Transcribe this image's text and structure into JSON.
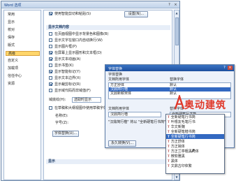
{
  "window": {
    "title": "Word 选项",
    "help": "?",
    "close": "×"
  },
  "sidebar": {
    "items": [
      {
        "label": "常用"
      },
      {
        "label": "显示"
      },
      {
        "label": "校对"
      },
      {
        "label": "保存"
      },
      {
        "label": "版式"
      },
      {
        "label": "高级"
      },
      {
        "label": "自定义"
      },
      {
        "label": "加载项"
      },
      {
        "label": "信任中心"
      },
      {
        "label": "资源"
      }
    ],
    "active_index": 5
  },
  "main": {
    "top_option": "使用智能剪切和粘贴(S)",
    "settings_button": "设置(N)...",
    "section_show_doc": "显示文档内容",
    "options": [
      {
        "label": "在页面视图中显示背景色和图像(B)",
        "checked": false
      },
      {
        "label": "显示文字在窗口内自动换行(W)",
        "checked": false
      },
      {
        "label": "显示图片框(P)",
        "checked": false
      },
      {
        "label": "在屏幕上显示图形和文本框(D)",
        "checked": true
      },
      {
        "label": "显示文本动画(A)",
        "checked": true
      },
      {
        "label": "显示书签(K)",
        "checked": false
      },
      {
        "label": "显示智能标记(Y)",
        "checked": true
      },
      {
        "label": "显示文本边界(X)",
        "checked": false
      },
      {
        "label": "显示裁剪标记(R)",
        "checked": true
      },
      {
        "label": "显示域代码而非域值(F)",
        "checked": false
      }
    ],
    "field_shading_label": "域底纹(H):",
    "field_shading_value": "选取时显示",
    "draft_option": "在草稿和大纲视图中使用草稿字体",
    "name_label": "名称(E):",
    "size_label": "字号(Z):",
    "font_sub_button": "字体替换(U)...",
    "section_display": "显示"
  },
  "dialog": {
    "title": "字体替换",
    "help": "?",
    "close": "×",
    "sub_label": "字体替换",
    "missing_label": "文档所用字体",
    "replace_label": "替换字体",
    "list_missing": [
      {
        "name": "方正舒体",
        "replace": "默认"
      },
      {
        "name": "汉鼎简行楷",
        "replace": "默认"
      },
      {
        "name": "文鼎新颖宋体",
        "replace": "默认"
      }
    ],
    "selected_index": 1,
    "font_used_label": "文档所用字体",
    "font_used_value": "汉鼎简行楷",
    "replace_font_label": "替换字体",
    "replace_font_value": "全新硬笔行书简",
    "note": "\"汉鼎简行楷\" 将以 \"全新硬笔行书简\" 来显示",
    "permanent_button": "永久转换(V)..."
  },
  "dropdown": {
    "items": [
      {
        "label": "全新硬笔行书简",
        "selected": false
      },
      {
        "label": "叶根友毛笔行书",
        "selected": false
      },
      {
        "label": "华文新魏",
        "selected": false
      },
      {
        "label": "全新硬笔楷书简",
        "selected": false
      },
      {
        "label": "全新硬笔行书简",
        "selected": true
      },
      {
        "label": "方正舒体",
        "selected": false
      },
      {
        "label": "方正姚体",
        "selected": false
      },
      {
        "label": "方正兰亭粗黑简体",
        "selected": false
      },
      {
        "label": "微软雅黑",
        "selected": false
      },
      {
        "label": "黑体",
        "selected": false
      },
      {
        "label": "文鼎古印体繁",
        "selected": false
      }
    ]
  },
  "watermark": {
    "text": "奥动建筑"
  },
  "colors": {
    "accent": "#3369c1",
    "active_item": "#ffd66b",
    "logo": "#e03a2c"
  }
}
